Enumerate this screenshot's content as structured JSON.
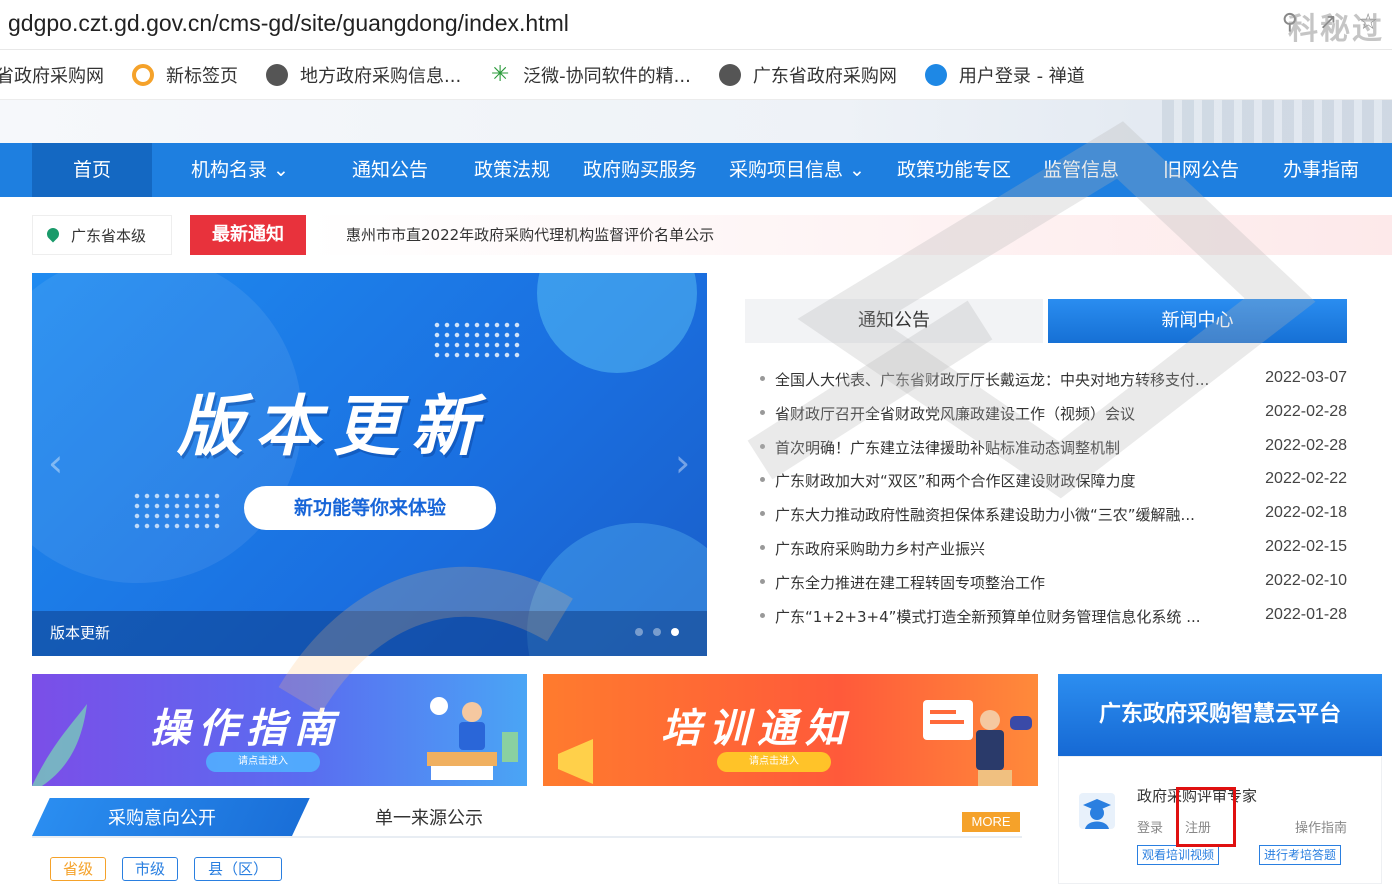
{
  "browser": {
    "url": "gdgpo.czt.gd.gov.cn/cms-gd/site/guangdong/index.html",
    "icons": [
      "search-icon",
      "share-icon",
      "star-icon"
    ]
  },
  "bookmarks": [
    {
      "label": "省政府采购网",
      "icon": "none"
    },
    {
      "label": "新标签页",
      "icon": "newtab-icon",
      "color": "#f5a22a"
    },
    {
      "label": "地方政府采购信息...",
      "icon": "globe-icon",
      "color": "#555555"
    },
    {
      "label": "泛微-协同软件的精...",
      "icon": "weaver-icon",
      "color": "#2a9a3a"
    },
    {
      "label": "广东省政府采购网",
      "icon": "globe-icon",
      "color": "#555555"
    },
    {
      "label": "用户登录 - 禅道",
      "icon": "zentao-icon",
      "color": "#1e88e5"
    }
  ],
  "nav": {
    "items": [
      {
        "label": "首页",
        "active": true
      },
      {
        "label": "机构名录",
        "dropdown": true
      },
      {
        "label": "通知公告"
      },
      {
        "label": "政策法规"
      },
      {
        "label": "政府购买服务"
      },
      {
        "label": "采购项目信息",
        "dropdown": true
      },
      {
        "label": "政策功能专区"
      },
      {
        "label": "监管信息"
      },
      {
        "label": "旧网公告"
      },
      {
        "label": "办事指南"
      }
    ]
  },
  "notice": {
    "location": "广东省本级",
    "badge": "最新通知",
    "text": "惠州市市直2022年政府采购代理机构监督评价名单公示"
  },
  "carousel": {
    "title": "版本更新",
    "button": "新功能等你来体验",
    "caption": "版本更新",
    "slides": 3,
    "current": 3
  },
  "news": {
    "tabs": [
      "通知公告",
      "新闻中心"
    ],
    "active_tab": 1,
    "items": [
      {
        "title": "全国人大代表、广东省财政厅厅长戴运龙：中央对地方转移支付...",
        "date": "2022-03-07"
      },
      {
        "title": "省财政厅召开全省财政党风廉政建设工作（视频）会议",
        "date": "2022-02-28"
      },
      {
        "title": "首次明确！广东建立法律援助补贴标准动态调整机制",
        "date": "2022-02-28"
      },
      {
        "title": "广东财政加大对“双区”和两个合作区建设财政保障力度",
        "date": "2022-02-22"
      },
      {
        "title": "广东大力推动政府性融资担保体系建设助力小微“三农”缓解融...",
        "date": "2022-02-18"
      },
      {
        "title": "广东政府采购助力乡村产业振兴",
        "date": "2022-02-15"
      },
      {
        "title": "广东全力推进在建工程转固专项整治工作",
        "date": "2022-02-10"
      },
      {
        "title": "广东“1+2+3+4”模式打造全新预算单位财务管理信息化系统 ...",
        "date": "2022-01-28"
      }
    ]
  },
  "promos": [
    {
      "title": "操作指南",
      "button": "请点击进入"
    },
    {
      "title": "培训通知",
      "button": "请点击进入"
    }
  ],
  "cloud": {
    "title": "广东政府采购智慧云平台",
    "expert_title": "政府采购评审专家",
    "login": "登录",
    "register": "注册",
    "guide": "操作指南",
    "btn_video": "观看培训视频",
    "btn_exam": "进行考培答题"
  },
  "bottom": {
    "tab1": "采购意向公开",
    "tab2": "单一来源公示",
    "more": "MORE",
    "chips": [
      "省级",
      "市级",
      "县（区）"
    ],
    "selected_chip": 0
  },
  "watermark": "科秘过"
}
